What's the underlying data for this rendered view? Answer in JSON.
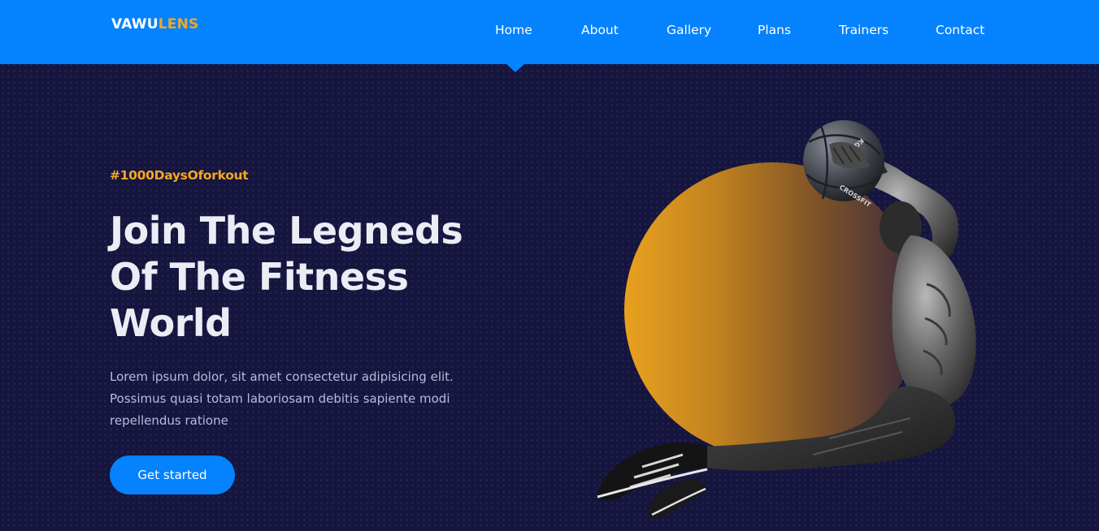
{
  "brand": {
    "name_primary": "VAWU",
    "name_accent": "LENS"
  },
  "nav": {
    "items": [
      {
        "label": "Home",
        "active": true
      },
      {
        "label": "About"
      },
      {
        "label": "Gallery"
      },
      {
        "label": "Plans"
      },
      {
        "label": "Trainers"
      },
      {
        "label": "Contact"
      }
    ]
  },
  "hero": {
    "hashtag": "#1000DaysOforkout",
    "headline": {
      "line1": "Join The Legneds",
      "line2": "Of The Fitness",
      "line3": "World"
    },
    "description": {
      "line1": "Lorem ipsum dolor, sit amet consectetur adipisicing elit.",
      "line2": "Possimus quasi totam laboriosam debitis sapiente modi",
      "line3": "repellendus ratione"
    },
    "cta_label": "Get started",
    "ball_text": "CROSSFIT",
    "ball_weight": "KG"
  },
  "colors": {
    "nav_bg": "#0582fd",
    "page_bg": "#15153d",
    "accent": "#f5a623",
    "headline": "#ececf5",
    "body_text": "#b9bbdc"
  }
}
